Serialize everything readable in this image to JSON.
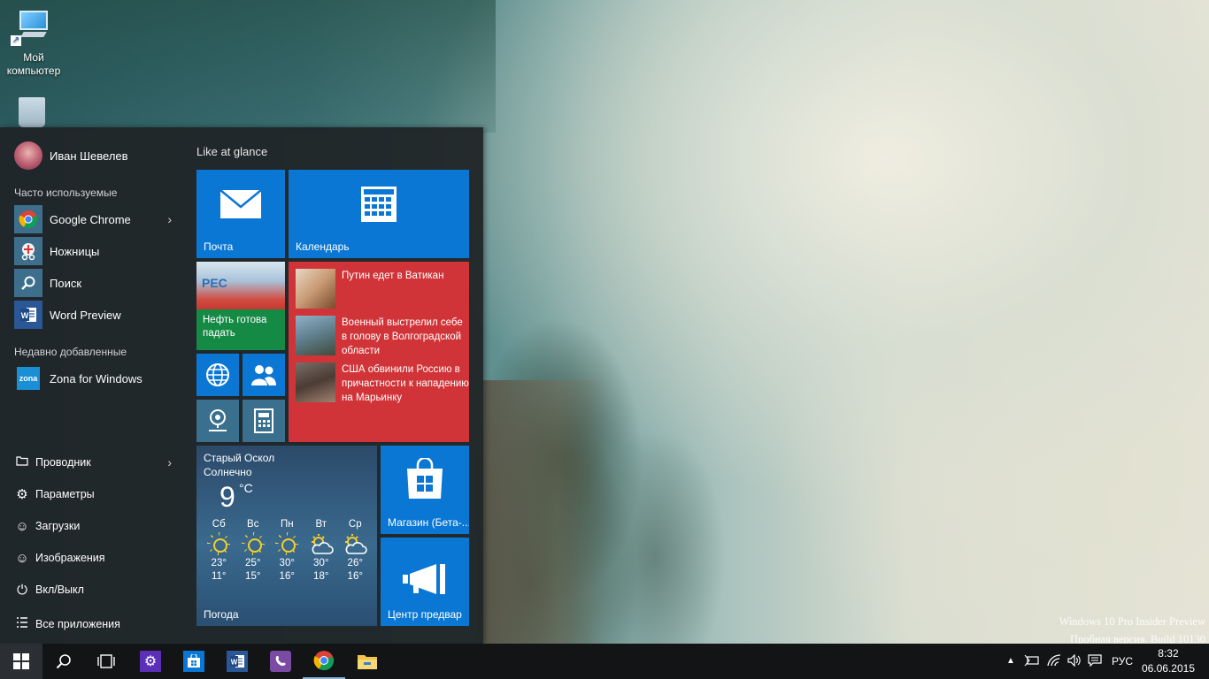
{
  "desktop": {
    "icons": [
      {
        "label": "Мой компьютер",
        "icon": "computer-icon"
      },
      {
        "label": "",
        "icon": "recycle-bin-icon"
      }
    ],
    "watermark": {
      "line1": "Windows 10 Pro Insider Preview",
      "line2": "Пробная версия. Build 10130"
    }
  },
  "start_menu": {
    "user_name": "Иван Шевелев",
    "most_used_label": "Часто используемые",
    "most_used": [
      {
        "label": "Google Chrome",
        "icon": "chrome-icon",
        "has_submenu": true
      },
      {
        "label": "Ножницы",
        "icon": "snipping-tool-icon"
      },
      {
        "label": "Поиск",
        "icon": "search-icon"
      },
      {
        "label": "Word Preview",
        "icon": "word-icon"
      }
    ],
    "recent_label": "Недавно добавленные",
    "recent": [
      {
        "label": "Zona for Windows",
        "icon": "zona-icon",
        "icon_text": "zona"
      }
    ],
    "system": [
      {
        "label": "Проводник",
        "icon": "folder-icon",
        "has_submenu": true
      },
      {
        "label": "Параметры",
        "icon": "gear-icon"
      },
      {
        "label": "Загрузки",
        "icon": "smiley-icon"
      },
      {
        "label": "Изображения",
        "icon": "smiley-icon"
      },
      {
        "label": "Вкл/Выкл",
        "icon": "power-icon"
      },
      {
        "label": "Все приложения",
        "icon": "all-apps-icon"
      }
    ],
    "tiles_group_title": "Like at glance",
    "tiles": {
      "mail": "Почта",
      "calendar": "Календарь",
      "finance": "Нефть готова падать",
      "finance_image_text": "PEC",
      "news": [
        "Путин едет в Ватикан",
        "Военный выстрелил себе в голову в Волгоградской области",
        "США обвинили Россию в причастности к нападению на Марьинку"
      ],
      "store": "Магазин (Бета-...",
      "feedback": "Центр предвар",
      "weather": {
        "city": "Старый Оскол",
        "condition": "Солнечно",
        "temp": "9",
        "unit": "°C",
        "label": "Погода",
        "forecast": [
          {
            "day": "Сб",
            "hi": "23°",
            "lo": "11°",
            "icon": "sun-icon"
          },
          {
            "day": "Вс",
            "hi": "25°",
            "lo": "15°",
            "icon": "sun-icon"
          },
          {
            "day": "Пн",
            "hi": "30°",
            "lo": "16°",
            "icon": "sun-icon"
          },
          {
            "day": "Вт",
            "hi": "30°",
            "lo": "18°",
            "icon": "partly-cloudy-icon"
          },
          {
            "day": "Ср",
            "hi": "26°",
            "lo": "16°",
            "icon": "partly-cloudy-icon"
          }
        ]
      }
    }
  },
  "taskbar": {
    "language": "РУС",
    "time": "8:32",
    "date": "06.06.2015",
    "colors": {
      "settings": "#5b2fb8",
      "store": "#0a77d4",
      "word": "#2b5797",
      "viber": "#7b4ba3",
      "explorer": "#f3c34a"
    }
  }
}
